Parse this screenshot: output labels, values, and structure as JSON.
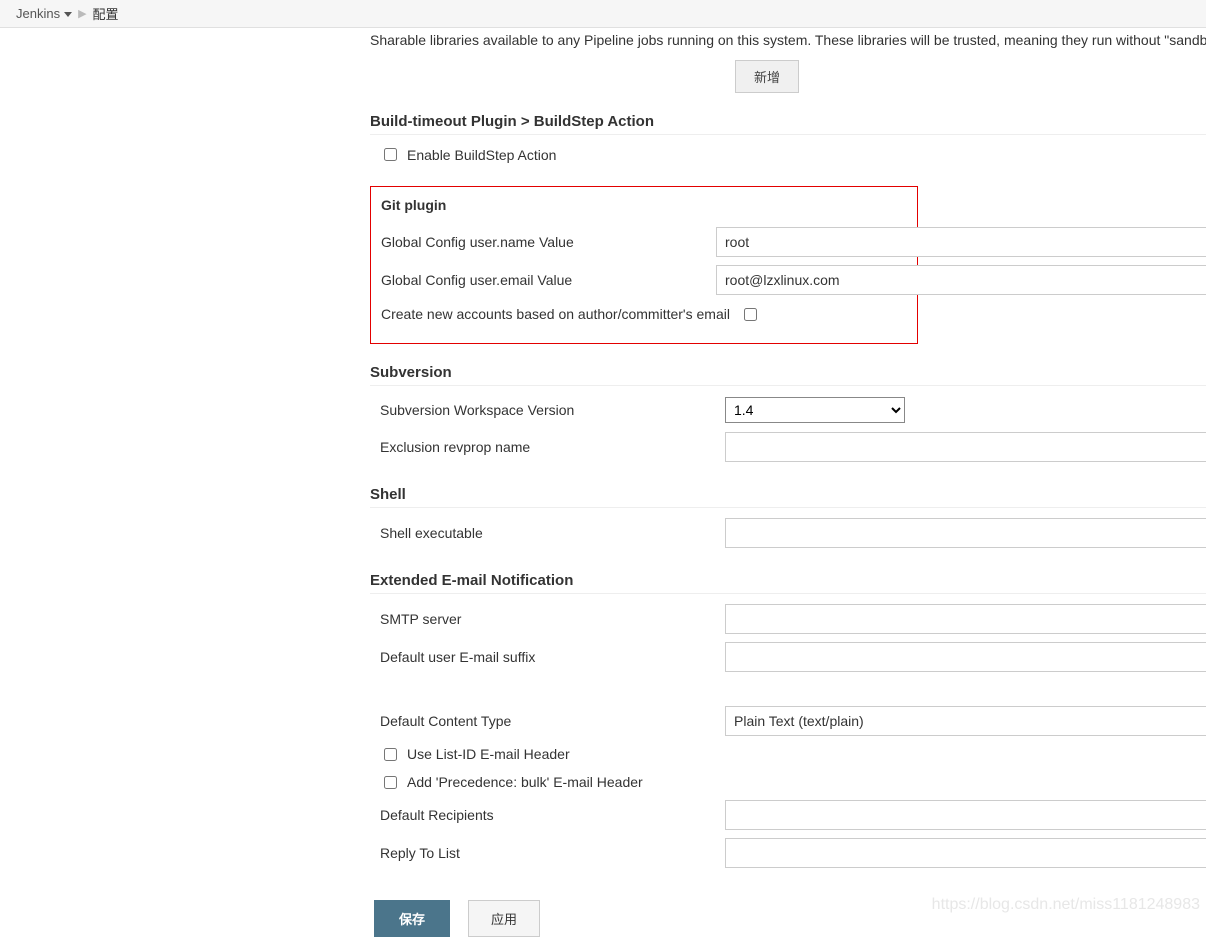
{
  "breadcrumb": {
    "root": "Jenkins",
    "current": "配置"
  },
  "pipeline_libs": {
    "desc": "Sharable libraries available to any Pipeline jobs running on this system. These libraries will be trusted, meaning they run without \"sandb",
    "add_btn": "新增"
  },
  "build_timeout": {
    "heading": "Build-timeout Plugin > BuildStep Action",
    "enable_label": "Enable BuildStep Action"
  },
  "git": {
    "heading": "Git plugin",
    "name_label": "Global Config user.name Value",
    "name_value": "root",
    "email_label": "Global Config user.email Value",
    "email_value": "root@lzxlinux.com",
    "create_accounts_label": "Create new accounts based on author/committer's email"
  },
  "svn": {
    "heading": "Subversion",
    "ws_version_label": "Subversion Workspace Version",
    "ws_version_value": "1.4",
    "exclusion_label": "Exclusion revprop name",
    "exclusion_value": ""
  },
  "shell": {
    "heading": "Shell",
    "exec_label": "Shell executable",
    "exec_value": ""
  },
  "email": {
    "heading": "Extended E-mail Notification",
    "smtp_label": "SMTP server",
    "smtp_value": "",
    "suffix_label": "Default user E-mail suffix",
    "suffix_value": "",
    "content_type_label": "Default Content Type",
    "content_type_value": "Plain Text (text/plain)",
    "list_id_label": "Use List-ID E-mail Header",
    "precedence_label": "Add 'Precedence: bulk' E-mail Header",
    "recipients_label": "Default Recipients",
    "recipients_value": "",
    "reply_to_label": "Reply To List",
    "reply_to_value": ""
  },
  "actions": {
    "save": "保存",
    "apply": "应用"
  },
  "watermark": "https://blog.csdn.net/miss1181248983"
}
